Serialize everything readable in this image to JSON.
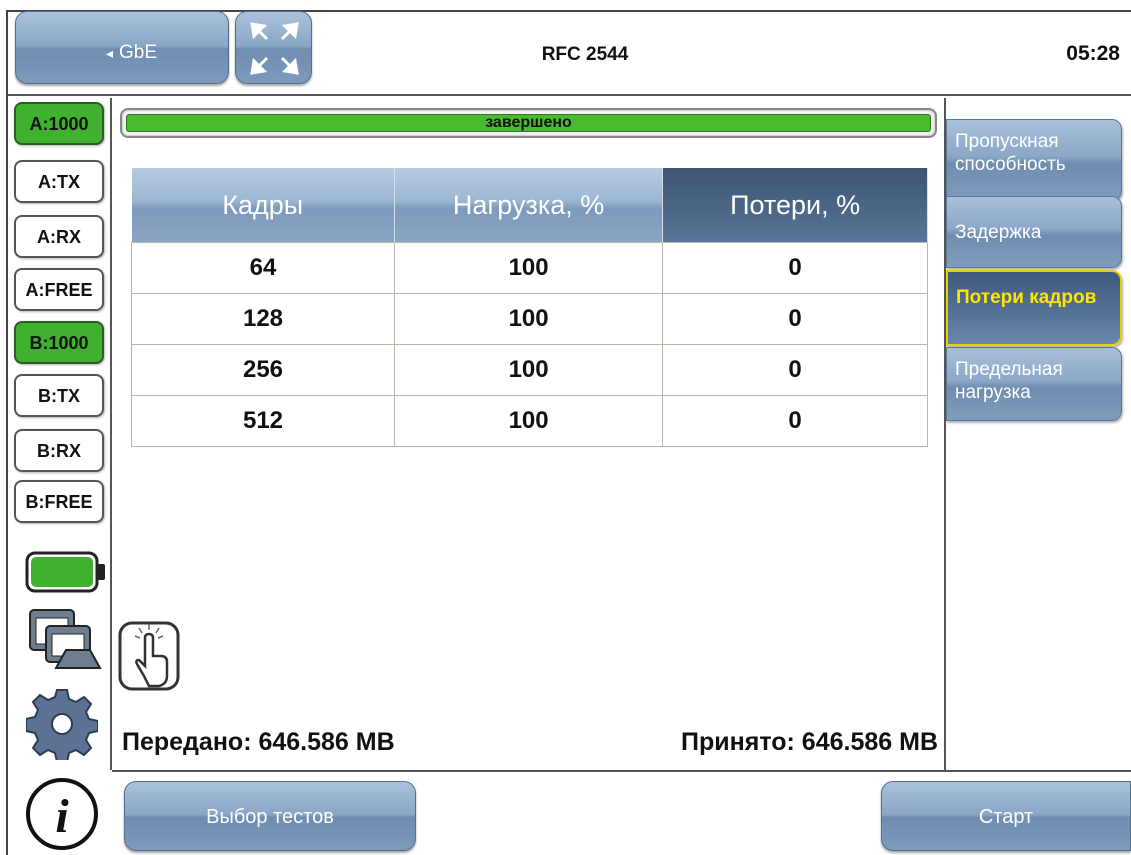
{
  "header": {
    "back_label": "GbE",
    "back_arrow": "◂",
    "title": "RFC 2544",
    "time": "05:28"
  },
  "ports": [
    {
      "label": "A:1000",
      "active": true
    },
    {
      "label": "A:TX",
      "active": false
    },
    {
      "label": "A:RX",
      "active": false
    },
    {
      "label": "A:FREE",
      "active": false
    },
    {
      "label": "B:1000",
      "active": true
    },
    {
      "label": "B:TX",
      "active": false
    },
    {
      "label": "B:RX",
      "active": false
    },
    {
      "label": "B:FREE",
      "active": false
    }
  ],
  "progress": {
    "label": "завершено",
    "fraction": 1.0
  },
  "table": {
    "headers": [
      "Кадры",
      "Нагрузка, %",
      "Потери, %"
    ],
    "selected_column": 2,
    "rows": [
      [
        "64",
        "100",
        "0"
      ],
      [
        "128",
        "100",
        "0"
      ],
      [
        "256",
        "100",
        "0"
      ],
      [
        "512",
        "100",
        "0"
      ]
    ]
  },
  "tabs": [
    {
      "label": "Пропускная способность",
      "active": false
    },
    {
      "label": "Задержка",
      "active": false
    },
    {
      "label": "Потери кадров",
      "active": true
    },
    {
      "label": "Предельная нагрузка",
      "active": false
    }
  ],
  "totals": {
    "sent": "Передано: 646.586 MB",
    "received": "Принято: 646.586 MB"
  },
  "footer": {
    "select_tests": "Выбор тестов",
    "start": "Старт"
  },
  "icons": {
    "battery": "battery-icon",
    "windows": "windows-icon",
    "settings": "gear-icon",
    "info": "info-icon",
    "touch": "touch-icon",
    "fullscreen": "fullscreen-icon"
  },
  "colors": {
    "active_green": "#3fb12f",
    "tab_active_text": "#ffe500",
    "button_blue": "#8aa6c6"
  }
}
